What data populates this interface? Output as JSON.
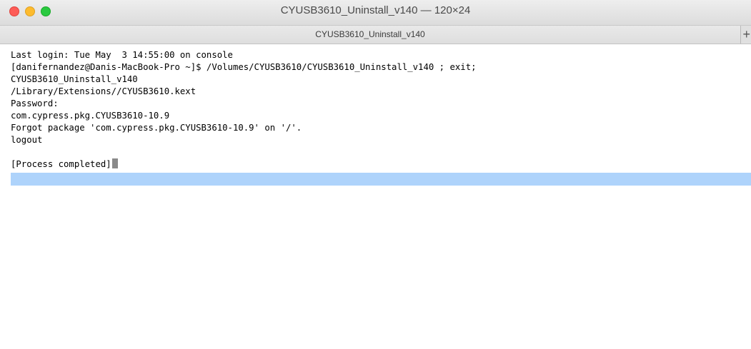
{
  "window": {
    "title": "CYUSB3610_Uninstall_v140 — 120×24"
  },
  "tabs": [
    {
      "label": "CYUSB3610_Uninstall_v140"
    }
  ],
  "new_tab_symbol": "+",
  "terminal": {
    "lines": [
      "Last login: Tue May  3 14:55:00 on console",
      "[danifernandez@Danis-MacBook-Pro ~]$ /Volumes/CYUSB3610/CYUSB3610_Uninstall_v140 ; exit;",
      "CYUSB3610_Uninstall_v140",
      "/Library/Extensions//CYUSB3610.kext",
      "Password:",
      "com.cypress.pkg.CYUSB3610-10.9",
      "Forgot package 'com.cypress.pkg.CYUSB3610-10.9' on '/'.",
      "logout",
      "",
      "[Process completed]"
    ]
  },
  "colors": {
    "close": "#fd5c57",
    "minimize": "#fdbb2e",
    "zoom": "#2ac940",
    "selection": "#aed3fb"
  }
}
